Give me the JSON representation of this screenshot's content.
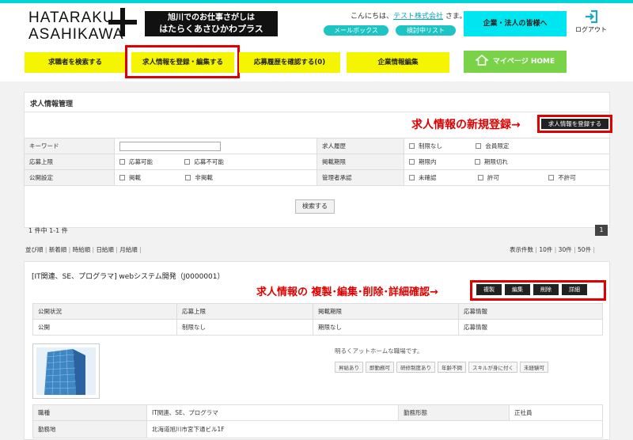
{
  "header": {
    "logo_line1": "HATARAKU",
    "logo_line2": "ASAHIKAWA",
    "logo_box_line1": "旭川でのお仕事さがしは",
    "logo_box_line2": "はたらくあさひかわプラス",
    "greeting_prefix": "こんにちは、",
    "company": "テスト株式会社",
    "greeting_suffix": " さま。",
    "mailbox": "メールボックス",
    "watchlist": "検討中リスト",
    "corp_button": "企業・法人の皆様へ",
    "logout": "ログアウト"
  },
  "nav": {
    "search_seekers": "求職者を検索する",
    "register_jobs": "求人情報を登録・編集する",
    "applications": "応募履歴を確認する(0)",
    "company_edit": "企業情報編集",
    "mypage": "マイページ HOME"
  },
  "panel": {
    "title": "求人情報管理",
    "annotation_register": "求人情報の新規登録→",
    "register_button": "求人情報を登録する"
  },
  "filters": {
    "keyword_label": "キーワード",
    "keyword_value": "",
    "salary_label": "求人履歴",
    "salary_opts": [
      "制限なし",
      "会員限定"
    ],
    "apply_limit_label": "応募上限",
    "apply_limit_opts": [
      "応募可能",
      "応募不可能"
    ],
    "period_label": "掲載期限",
    "period_opts": [
      "期限内",
      "期限切れ"
    ],
    "public_label": "公開設定",
    "public_opts": [
      "掲載",
      "非掲載"
    ],
    "admin_label": "管理者承認",
    "admin_opts": [
      "未確認",
      "許可",
      "不許可"
    ],
    "search_button": "検索する"
  },
  "results": {
    "count_text": "1 件中 1-1 件",
    "page": "1",
    "sort_label": "並び順",
    "sorts": [
      "新着順",
      "時給順",
      "日給順",
      "月給順"
    ],
    "per_page_label": "表示件数",
    "per_page": [
      "10件",
      "30件",
      "50件"
    ]
  },
  "job": {
    "title": "[IT関連、SE、プログラマ] webシステム開発（J0000001）",
    "annotation_actions": "求人情報の 複製･編集･削除･詳細確認→",
    "actions": [
      "複製",
      "編集",
      "削除",
      "詳細"
    ],
    "status_headers": [
      "公開状況",
      "応募上限",
      "掲載期限",
      "応募情報"
    ],
    "status_values": [
      "公開",
      "制限なし",
      "期限なし",
      "応募情報"
    ],
    "description": "明るくアットホームな職場です。",
    "tags": [
      "昇給あり",
      "即勤務可",
      "研修制度あり",
      "年齢不問",
      "スキルが身に付く",
      "未経験可"
    ],
    "detail_rows": [
      {
        "label": "職種",
        "value": "IT関連、SE、プログラマ",
        "label2": "勤務形態",
        "value2": "正社員"
      },
      {
        "label": "勤務地",
        "value": "北海道旭川市宮下通ビル1F",
        "label2": "",
        "value2": ""
      }
    ]
  },
  "colors": {
    "accent_cyan": "#00d4d4",
    "nav_yellow": "#f6f500",
    "home_green": "#7ad248",
    "annotation_red": "#e00000"
  }
}
